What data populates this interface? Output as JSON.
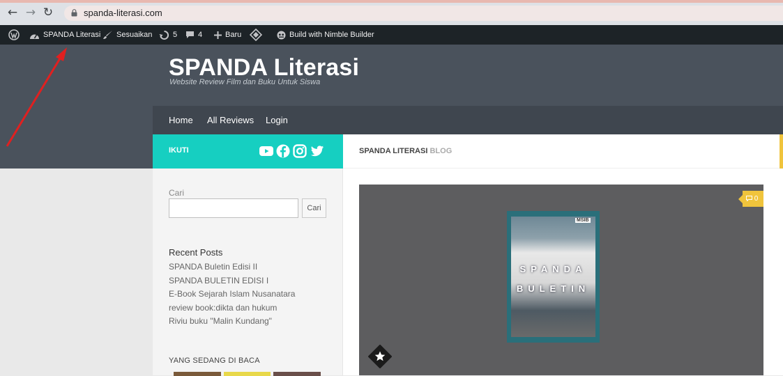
{
  "browser": {
    "url": "spanda-literasi.com"
  },
  "adminbar": {
    "site_name": "SPANDA Literasi",
    "customize": "Sesuaikan",
    "updates_count": "5",
    "comments_count": "4",
    "new": "Baru",
    "builder": "Build with Nimble Builder"
  },
  "header": {
    "title": "SPANDA Literasi",
    "description": "Website Review Film dan Buku Untuk Siswa"
  },
  "nav": {
    "items": [
      "Home",
      "All Reviews",
      "Login"
    ]
  },
  "follow": {
    "label": "IKUTI",
    "icons": [
      "youtube-icon",
      "facebook-icon",
      "instagram-icon",
      "twitter-icon"
    ]
  },
  "content_header": {
    "main": "SPANDA LITERASI",
    "sub": "BLOG"
  },
  "sidebar": {
    "search_label": "Cari",
    "search_value": "",
    "search_button": "Cari",
    "recent_title": "Recent Posts",
    "recent_posts": [
      "SPANDA Buletin Edisi II",
      "SPANDA BULETIN EDISI I",
      "E-Book Sejarah Islam Nusanatara",
      "review book:dikta dan hukum",
      "Riviu buku \"Malin Kundang\""
    ],
    "reading_title": "YANG SEDANG DI BACA"
  },
  "post": {
    "comments": "0",
    "cover_line1": "SPANDA",
    "cover_line2": "BULETIN",
    "cover_logo": "MSIB"
  },
  "colors": {
    "admin_bar": "#1d2327",
    "header": "#4a525c",
    "nav": "#3f464f",
    "follow": "#16cfc1",
    "accent": "#f0c43c",
    "annotation": "#e02020"
  }
}
